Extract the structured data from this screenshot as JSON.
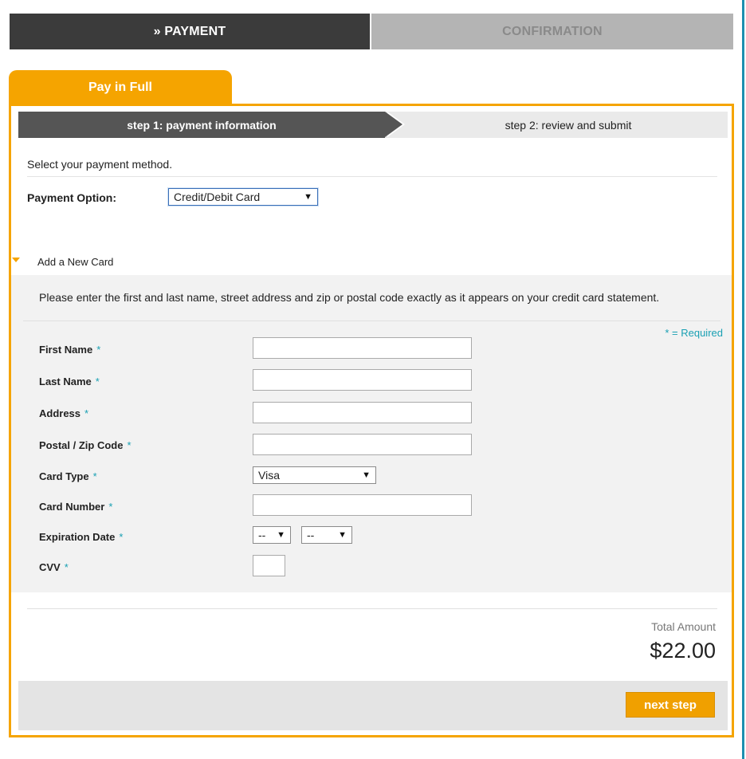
{
  "progress": {
    "step_payment": "» PAYMENT",
    "step_confirmation": "CONFIRMATION"
  },
  "pay_tab": {
    "label": "Pay in Full"
  },
  "stepbar": {
    "step1": "step 1: payment information",
    "step2": "step 2: review and submit"
  },
  "method": {
    "prompt": "Select your payment method.",
    "option_label": "Payment Option:",
    "option_value": "Credit/Debit Card"
  },
  "add_card": {
    "toggle_label": "Add a New Card",
    "instructions": "Please enter the first and last name, street address and zip or postal code exactly as it appears on your credit card statement.",
    "required_note": "* = Required",
    "required_marker": "*",
    "fields": {
      "first_name": "First Name",
      "last_name": "Last Name",
      "address": "Address",
      "postal": "Postal / Zip Code",
      "card_type": "Card Type",
      "card_number": "Card Number",
      "expiration": "Expiration Date",
      "cvv": "CVV"
    },
    "card_type_value": "Visa",
    "exp_month_value": "--",
    "exp_year_value": "--"
  },
  "total": {
    "label": "Total Amount",
    "amount": "$22.00"
  },
  "footer": {
    "next_label": "next step"
  },
  "icons": {
    "dropdown_caret": "▼",
    "collapse_triangle": "triangle-down-icon"
  },
  "colors": {
    "accent": "#f5a400",
    "dark_tab": "#3b3b3b",
    "required": "#1aa0b3"
  }
}
